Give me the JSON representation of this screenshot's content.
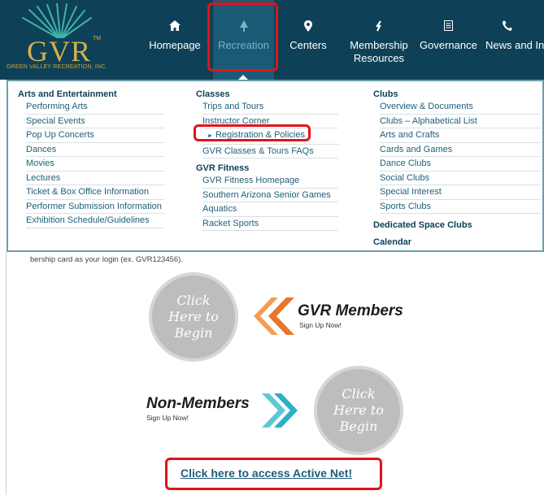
{
  "logo": {
    "text": "GVR",
    "tm": "TM",
    "tagline": "GREEN VALLEY RECREATION, INC."
  },
  "nav": [
    {
      "label": "Homepage",
      "icon": "home-icon"
    },
    {
      "label": "Recreation",
      "icon": "tree-icon"
    },
    {
      "label": "Centers",
      "icon": "map-pin-icon"
    },
    {
      "label": "Membership Resources",
      "icon": "dollar-icon"
    },
    {
      "label": "Governance",
      "icon": "document-icon"
    },
    {
      "label": "News and Info",
      "icon": "phone-icon"
    }
  ],
  "menu": {
    "arts": {
      "heading": "Arts and Entertainment",
      "items": [
        "Performing Arts",
        "Special Events",
        "Pop Up Concerts",
        "Dances",
        "Movies",
        "Lectures",
        "Ticket & Box Office Information",
        "Performer Submission Information",
        "Exhibition Schedule/Guidelines"
      ]
    },
    "classes": {
      "heading": "Classes",
      "items": [
        "Trips and Tours",
        "Instructor Corner",
        "Registration & Policies",
        "GVR Classes & Tours FAQs"
      ],
      "selected_marker": "►"
    },
    "fitness": {
      "heading": "GVR Fitness",
      "items": [
        "GVR Fitness Homepage",
        "Southern Arizona Senior Games",
        "Aquatics",
        "Racket Sports"
      ]
    },
    "clubs": {
      "heading": "Clubs",
      "items": [
        "Overview & Documents",
        "Clubs – Alphabetical List",
        "Arts and Crafts",
        "Cards and Games",
        "Dance Clubs",
        "Social Clubs",
        "Special Interest",
        "Sports Clubs"
      ]
    },
    "dedicated": {
      "heading": "Dedicated Space Clubs"
    },
    "calendar": {
      "heading": "Calendar"
    }
  },
  "content": {
    "login_hint": "bership card as your login (ex. GVR123456).",
    "circle_lines": [
      "Click",
      "Here to",
      "Begin"
    ],
    "members_title": "GVR Members",
    "members_sub": "Sign Up Now!",
    "nonmembers_title": "Non-Members",
    "nonmembers_sub": "Sign Up Now!",
    "activenet_link": "Click here to access Active Net!"
  },
  "colors": {
    "nav_bg": "#0e4157",
    "accent_gold": "#d4b04a",
    "orange_chevron": "#e8762c",
    "teal_chevron": "#2ab1c7",
    "highlight_red": "#e0141b"
  }
}
